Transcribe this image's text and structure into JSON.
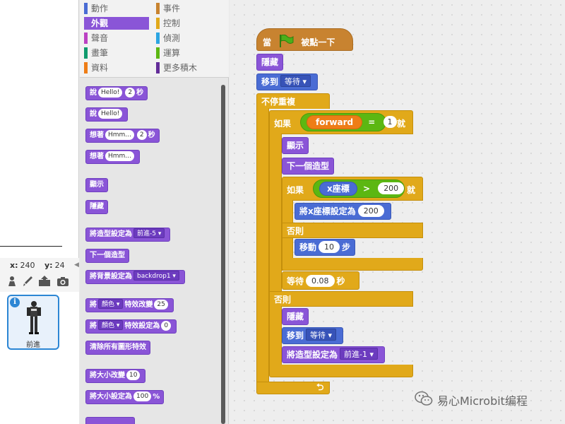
{
  "stage": {
    "coords": {
      "x_label": "x:",
      "x_value": "240",
      "y_label": "y:",
      "y_value": "24"
    }
  },
  "sprite_tools": [
    {
      "name": "sprite-library-icon",
      "glyph": "♟"
    },
    {
      "name": "paint-brush-icon",
      "glyph": "/"
    },
    {
      "name": "upload-icon",
      "glyph": "⬆"
    },
    {
      "name": "camera-icon",
      "glyph": "📷"
    }
  ],
  "sprite": {
    "name": "前進",
    "info": "i"
  },
  "categories": [
    {
      "label": "動作",
      "color": "#4a6cd4"
    },
    {
      "label": "事件",
      "color": "#c88330"
    },
    {
      "label": "外觀",
      "color": "#8a55d7",
      "active": true
    },
    {
      "label": "控制",
      "color": "#e1a91a"
    },
    {
      "label": "聲音",
      "color": "#bb42c3"
    },
    {
      "label": "偵測",
      "color": "#2ca5e2"
    },
    {
      "label": "畫筆",
      "color": "#0e9a6c"
    },
    {
      "label": "運算",
      "color": "#5cb712"
    },
    {
      "label": "資料",
      "color": "#ee7d16"
    },
    {
      "label": "更多積木",
      "color": "#632d99"
    }
  ],
  "palette": {
    "say_for": {
      "label": "說",
      "text": "Hello!",
      "secs": "2",
      "unit": "秒"
    },
    "say": {
      "label": "說",
      "text": "Hello!"
    },
    "think_for": {
      "label": "想著",
      "text": "Hmm...",
      "secs": "2",
      "unit": "秒"
    },
    "think": {
      "label": "想著",
      "text": "Hmm..."
    },
    "show": "顯示",
    "hide": "隱藏",
    "switch_costume": {
      "label": "將造型設定為",
      "value": "前進-5"
    },
    "next_costume": "下一個造型",
    "switch_backdrop": {
      "label": "將背景設定為",
      "value": "backdrop1"
    },
    "change_effect": {
      "label": "將",
      "effect": "顏色",
      "label2": "特效改變",
      "value": "25"
    },
    "set_effect": {
      "label": "將",
      "effect": "顏色",
      "label2": "特效設定為",
      "value": "0"
    },
    "clear_effects": "清除所有圖形特效",
    "change_size": {
      "label": "將大小改變",
      "value": "10"
    },
    "set_size": {
      "label": "將大小設定為",
      "value": "100",
      "unit": "%"
    },
    "more": "..."
  },
  "script": {
    "hat": {
      "pre": "當",
      "post": "被點一下"
    },
    "hide1": "隱藏",
    "goto1": {
      "label": "移到",
      "value": "等待"
    },
    "forever": "不停重複",
    "if1": {
      "label": "如果",
      "var": "forward",
      "op": "=",
      "value": "1",
      "then": "就"
    },
    "show": "顯示",
    "next_costume": "下一個造型",
    "if2": {
      "label": "如果",
      "sensor": "x座標",
      "op": ">",
      "value": "200",
      "then": "就"
    },
    "set_x": {
      "label": "將x座標設定為",
      "value": "200"
    },
    "else1": "否則",
    "move": {
      "label": "移動",
      "value": "10",
      "unit": "步"
    },
    "wait": {
      "label": "等待",
      "value": "0.08",
      "unit": "秒"
    },
    "else2": "否則",
    "hide2": "隱藏",
    "goto2": {
      "label": "移到",
      "value": "等待"
    },
    "switch_costume": {
      "label": "將造型設定為",
      "value": "前進-1"
    },
    "loop_arrow": "⮌"
  },
  "watermark": "易心Microbit编程"
}
